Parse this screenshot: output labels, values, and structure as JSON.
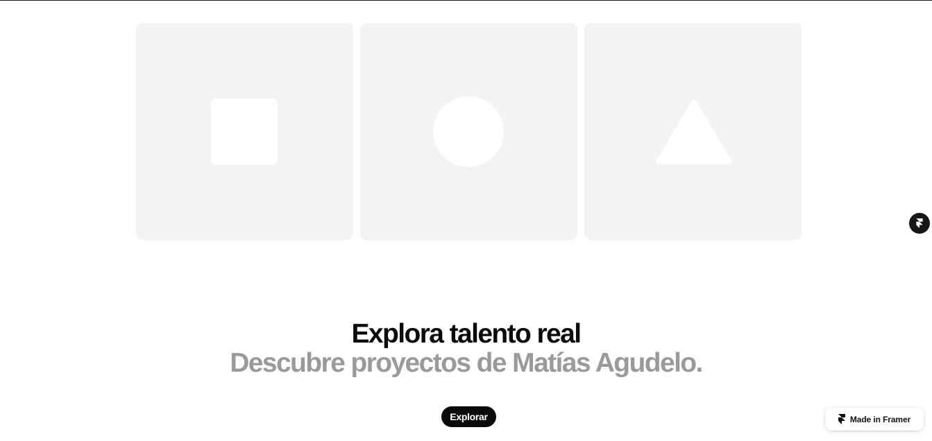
{
  "hero": {
    "cards": [
      {
        "shape": "square"
      },
      {
        "shape": "circle"
      },
      {
        "shape": "triangle"
      }
    ]
  },
  "cta": {
    "headline": "Explora talento real",
    "subheadline": "Descubre proyectos de Matías Agudelo.",
    "button_label": "Explorar"
  },
  "badges": {
    "side_icon": "framer-logo-icon",
    "made_in_framer_label": "Made in Framer",
    "made_in_framer_icon": "framer-logo-icon"
  },
  "colors": {
    "card_background": "#f3f3f3",
    "shape_fill": "#ffffff",
    "headline": "#0b0b0b",
    "subheadline": "#9a9a9a",
    "button_background": "#0a0a0a",
    "button_text": "#ffffff"
  }
}
